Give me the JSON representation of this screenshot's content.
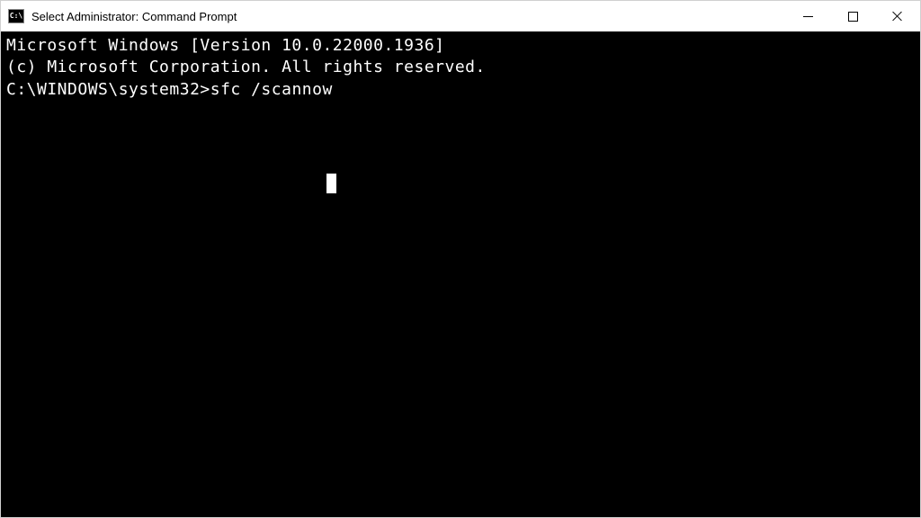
{
  "window": {
    "title": "Select Administrator: Command Prompt",
    "icon_label": "C:\\"
  },
  "terminal": {
    "line1": "Microsoft Windows [Version 10.0.22000.1936]",
    "line2": "(c) Microsoft Corporation. All rights reserved.",
    "blank": "",
    "prompt": "C:\\WINDOWS\\system32>",
    "command": "sfc /scannow"
  }
}
